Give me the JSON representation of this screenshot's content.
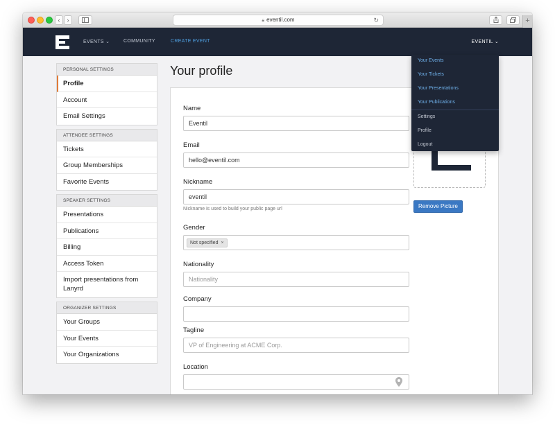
{
  "browser": {
    "url": "eventil.com",
    "back_glyph": "‹",
    "forward_glyph": "›",
    "new_tab_glyph": "+"
  },
  "nav": {
    "events_label": "EVENTS",
    "community_label": "COMMUNITY",
    "create_event_label": "CREATE EVENT",
    "user_label": "EVENTIL",
    "active_color": "#4f9fe0",
    "background": "#1e2636"
  },
  "dropdown": {
    "items": [
      "Your Events",
      "Your Tickets",
      "Your Presentations",
      "Your Publications",
      "Settings",
      "Profile",
      "Logout"
    ]
  },
  "sidebar": {
    "groups": [
      {
        "heading": "PERSONAL SETTINGS",
        "items": [
          "Profile",
          "Account",
          "Email Settings"
        ]
      },
      {
        "heading": "ATTENDEE SETTINGS",
        "items": [
          "Tickets",
          "Group Memberships",
          "Favorite Events"
        ]
      },
      {
        "heading": "SPEAKER SETTINGS",
        "items": [
          "Presentations",
          "Publications",
          "Billing",
          "Access Token",
          "Import presentations from Lanyrd"
        ]
      },
      {
        "heading": "ORGANIZER SETTINGS",
        "items": [
          "Your Groups",
          "Your Events",
          "Your Organizations"
        ]
      }
    ],
    "active_item": "Profile",
    "active_color": "#e07b39"
  },
  "page": {
    "title": "Your profile"
  },
  "form": {
    "name": {
      "label": "Name",
      "value": "Eventil"
    },
    "email": {
      "label": "Email",
      "value": "hello@eventil.com"
    },
    "nickname": {
      "label": "Nickname",
      "value": "eventil",
      "help": "Nickname is used to build your public page url"
    },
    "gender": {
      "label": "Gender",
      "tag": "Not specified",
      "remove": "×"
    },
    "nationality": {
      "label": "Nationality",
      "placeholder": "Nationality"
    },
    "company": {
      "label": "Company",
      "value": ""
    },
    "tagline": {
      "label": "Tagline",
      "placeholder": "VP of Engineering at ACME Corp."
    },
    "location": {
      "label": "Location",
      "value": ""
    }
  },
  "picture": {
    "remove_label": "Remove Picture",
    "button_color": "#3a78c3"
  }
}
